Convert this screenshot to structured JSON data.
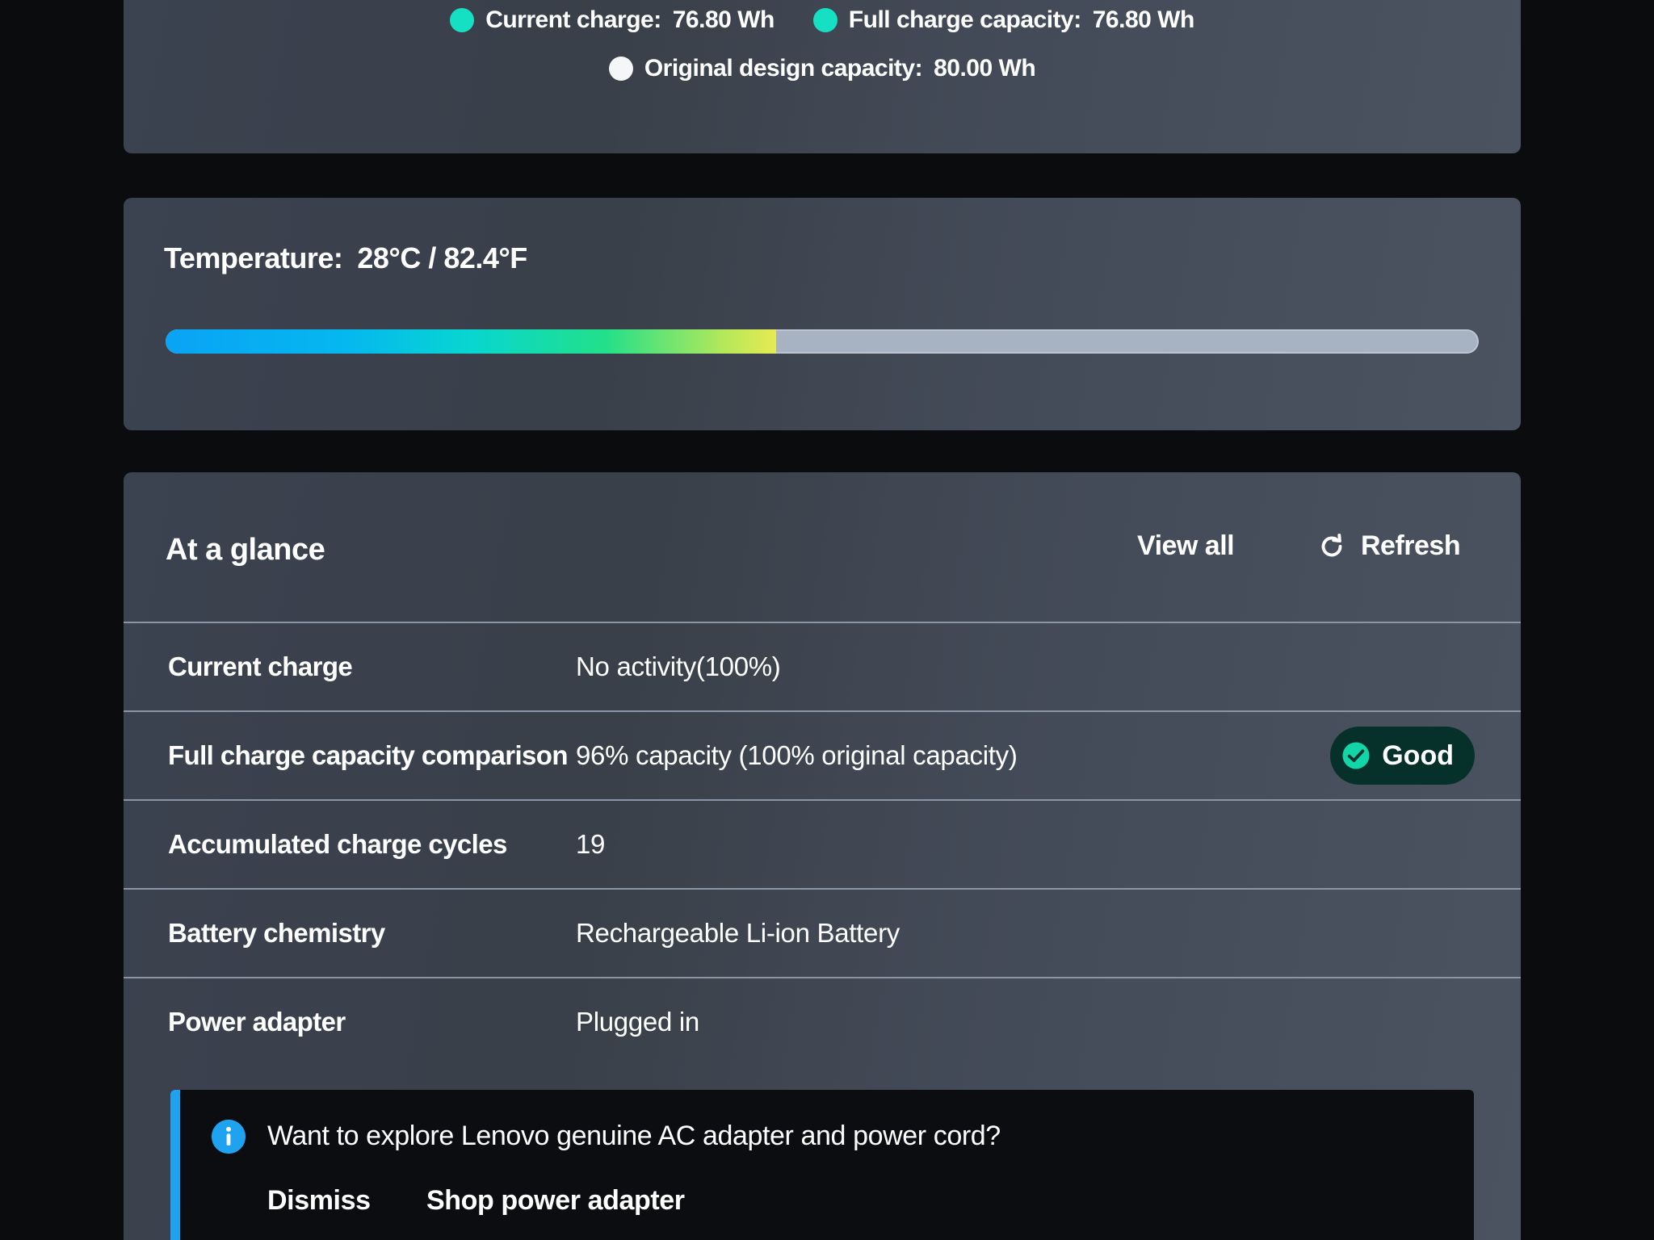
{
  "legend": {
    "items": [
      {
        "label": "Current charge:",
        "value": "76.80 Wh",
        "color": "#16e0c4"
      },
      {
        "label": "Full charge capacity:",
        "value": "76.80 Wh",
        "color": "#16e0c4"
      },
      {
        "label": "Original design capacity:",
        "value": "80.00 Wh",
        "color": "#f4f6f8"
      }
    ]
  },
  "temperature": {
    "label": "Temperature:",
    "value": "28°C / 82.4°F",
    "level_fraction": 0.465
  },
  "glance": {
    "title": "At a glance",
    "view_all": "View all",
    "refresh": "Refresh",
    "refresh_icon": "refresh-icon",
    "rows": [
      {
        "label": "Current charge",
        "value": "No activity(100%)"
      },
      {
        "label": "Full charge capacity comparison",
        "value": "96% capacity (100% original capacity)",
        "badge": "Good",
        "badge_icon": "check-circle-icon",
        "badge_color": "#12d6a8"
      },
      {
        "label": "Accumulated charge cycles",
        "value": "19"
      },
      {
        "label": "Battery chemistry",
        "value": "Rechargeable Li-ion Battery"
      },
      {
        "label": "Power adapter",
        "value": "Plugged in"
      }
    ]
  },
  "banner": {
    "icon": "info-icon",
    "accent": "#1fa3f0",
    "text": "Want to explore Lenovo genuine AC adapter and power cord?",
    "dismiss": "Dismiss",
    "shop": "Shop power adapter"
  }
}
